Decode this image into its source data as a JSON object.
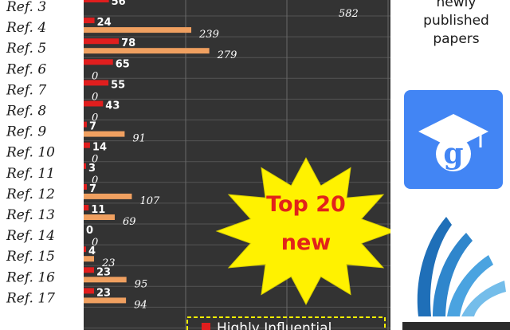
{
  "chart_data": {
    "type": "bar",
    "categories": [
      "Ref. 3",
      "Ref. 4",
      "Ref. 5",
      "Ref. 6",
      "Ref. 7",
      "Ref. 8",
      "Ref. 9",
      "Ref. 10",
      "Ref. 11",
      "Ref. 12",
      "Ref. 13",
      "Ref. 14",
      "Ref. 15",
      "Ref. 16",
      "Ref. 17"
    ],
    "series": [
      {
        "values": [
          56,
          24,
          78,
          65,
          55,
          43,
          7,
          14,
          3,
          7,
          11,
          0,
          4,
          23,
          23
        ]
      },
      {
        "values": [
          582,
          239,
          279,
          0,
          0,
          0,
          91,
          0,
          0,
          107,
          69,
          0,
          23,
          95,
          94
        ]
      }
    ],
    "colors": {
      "red": "#e01e1e",
      "orange": "#f0a060",
      "bg": "#333333",
      "star": "#fff200",
      "star_text": "#e2231a"
    },
    "annotations": {
      "star_line1": "Top 20",
      "star_line2": "new",
      "legend_text": "Highly Influential"
    },
    "grid": true
  },
  "side_panel": {
    "top_text": [
      "newly",
      "published",
      "papers"
    ],
    "icons": [
      "google-scholar-icon",
      "book-pages-icon"
    ]
  }
}
